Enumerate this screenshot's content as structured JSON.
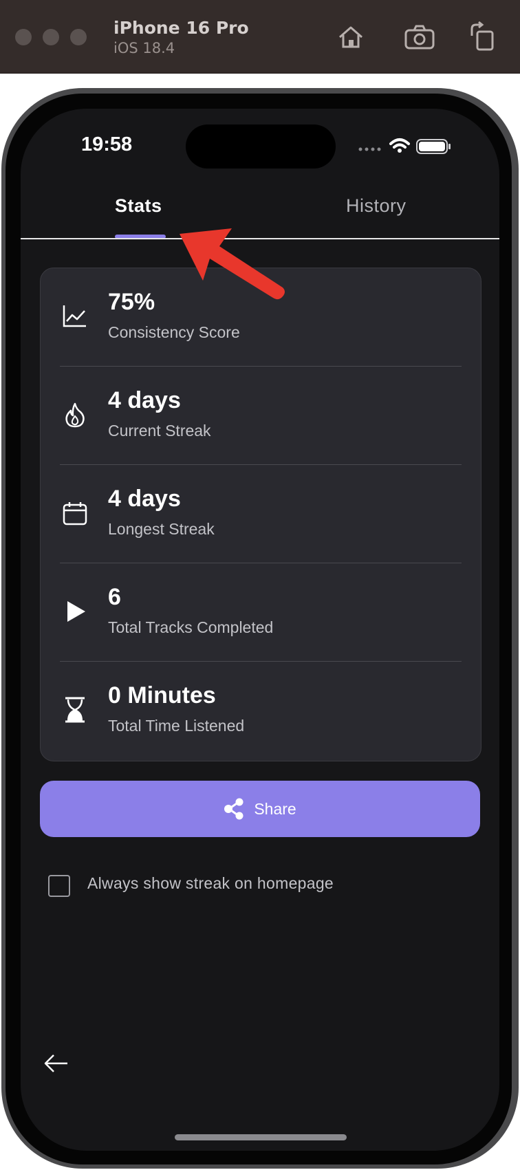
{
  "simulator": {
    "device_name": "iPhone 16 Pro",
    "os_version": "iOS 18.4",
    "icons": [
      "home-icon",
      "screenshot-icon",
      "rotate-icon"
    ]
  },
  "status_bar": {
    "time": "19:58",
    "icons": [
      "cellular-dots-icon",
      "wifi-icon",
      "battery-icon"
    ]
  },
  "tabs": [
    {
      "label": "Stats",
      "active": true
    },
    {
      "label": "History",
      "active": false
    }
  ],
  "stats": [
    {
      "icon": "chart-line-icon",
      "value": "75%",
      "label": "Consistency Score"
    },
    {
      "icon": "flame-icon",
      "value": "4 days",
      "label": "Current Streak"
    },
    {
      "icon": "calendar-icon",
      "value": "4 days",
      "label": "Longest Streak"
    },
    {
      "icon": "play-icon",
      "value": "6",
      "label": "Total Tracks Completed"
    },
    {
      "icon": "hourglass-icon",
      "value": "0 Minutes",
      "label": "Total Time Listened"
    }
  ],
  "share_button": {
    "label": "Share",
    "icon": "share-icon"
  },
  "homepage_checkbox": {
    "label": "Always show streak on homepage",
    "checked": false
  },
  "navigation": {
    "back_icon": "back-arrow-icon"
  },
  "annotation": {
    "icon": "red-arrow-icon",
    "color": "#e8372c"
  },
  "colors": {
    "accent": "#8b7fe8",
    "background": "#161618",
    "card": "#29292f"
  }
}
